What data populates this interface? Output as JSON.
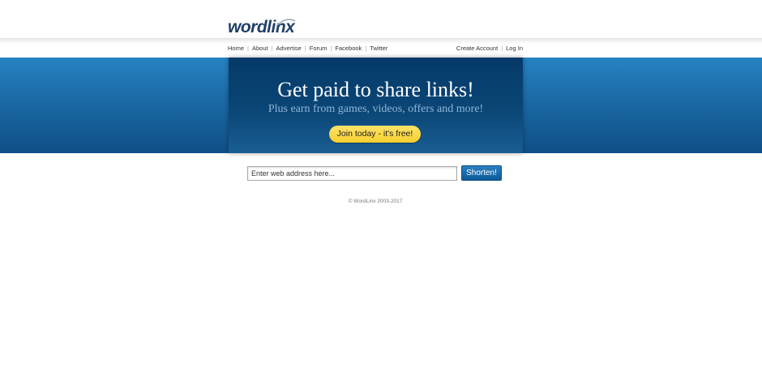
{
  "brand": {
    "name": "wordlinx",
    "color": "#1f3f66"
  },
  "nav": {
    "left": [
      {
        "label": "Home"
      },
      {
        "label": "About"
      },
      {
        "label": "Advertise"
      },
      {
        "label": "Forum"
      },
      {
        "label": "Facebook"
      },
      {
        "label": "Twitter"
      }
    ],
    "right": [
      {
        "label": "Create Account"
      },
      {
        "label": "Log In"
      }
    ],
    "separator": "|"
  },
  "hero": {
    "title": "Get paid to share links!",
    "subtitle": "Plus earn from games, videos, offers and more!",
    "cta_label": "Join today - it's free!",
    "cta_color": "#f6cf2e",
    "band_color": "#1b6aa6"
  },
  "shortener": {
    "placeholder": "Enter web address here...",
    "button_label": "Shorten!",
    "button_color": "#0d5a99"
  },
  "footer": {
    "copyright": "© WordLinx 2003-2017"
  }
}
